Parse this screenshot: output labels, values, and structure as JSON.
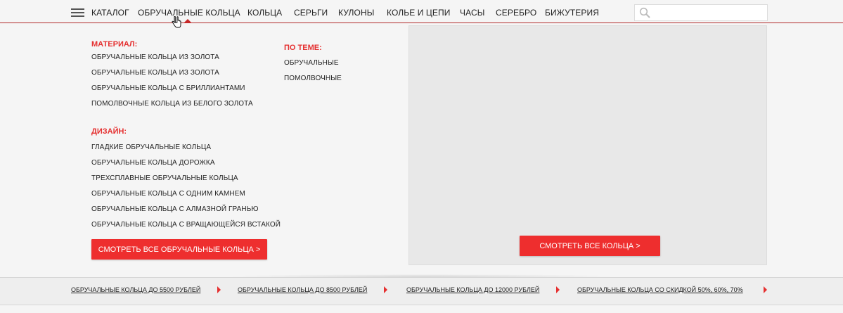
{
  "nav": {
    "catalog": "КАТАЛОГ",
    "items": [
      "ОБРУЧАЛЬНЫЕ КОЛЬЦА",
      "КОЛЬЦА",
      "СЕРЬГИ",
      "КУЛОНЫ",
      "КОЛЬЕ И ЦЕПИ",
      "ЧАСЫ",
      "СЕРЕБРО",
      "БИЖУТЕРИЯ"
    ],
    "active_index": 0
  },
  "search": {
    "placeholder": "",
    "value": ""
  },
  "dropdown": {
    "material": {
      "title": "МАТЕРИАЛ:",
      "links": [
        "ОБРУЧАЛЬНЫЕ КОЛЬЦА ИЗ ЗОЛОТА",
        "ОБРУЧАЛЬНЫЕ КОЛЬЦА ИЗ ЗОЛОТА",
        "ОБРУЧАЛЬНЫЕ КОЛЬЦА С БРИЛЛИАНТАМИ",
        "ПОМОЛВОЧНЫЕ КОЛЬЦА ИЗ БЕЛОГО ЗОЛОТА"
      ]
    },
    "design": {
      "title": "ДИЗАЙН:",
      "links": [
        "ГЛАДКИЕ ОБРУЧАЛЬНЫЕ КОЛЬЦА",
        "ОБРУЧАЛЬНЫЕ КОЛЬЦА ДОРОЖКА",
        "ТРЕХСПЛАВНЫЕ ОБРУЧАЛЬНЫЕ КОЛЬЦА",
        "ОБРУЧАЛЬНЫЕ КОЛЬЦА С ОДНИМ КАМНЕМ",
        "ОБРУЧАЛЬНЫЕ КОЛЬЦА С АЛМАЗНОЙ ГРАНЬЮ",
        "ОБРУЧАЛЬНЫЕ КОЛЬЦА С ВРАЩАЮЩЕЙСЯ ВСТАКОЙ"
      ]
    },
    "theme": {
      "title": "ПО ТЕМЕ:",
      "links": [
        "ОБРУЧАЛЬНЫЕ",
        "ПОМОЛВОЧНЫЕ"
      ]
    },
    "see_all_wedding_button": "СМОТРЕТЬ ВСЕ ОБРУЧАЛЬНЫЕ КОЛЬЦА >",
    "see_all_rings_button": "СМОТРЕТЬ ВСЕ  КОЛЬЦА >"
  },
  "bottom_links": [
    "ОБРУЧАЛЬНЫЕ КОЛЬЦА ДО 5500 РУБЛЕЙ",
    "ОБРУЧАЛЬНЫЕ КОЛЬЦА ДО 8500 РУБЛЕЙ",
    "ОБРУЧАЛЬНЫЕ КОЛЬЦА ДО 12000 РУБЛЕЙ",
    "ОБРУЧАЛЬНЫЕ КОЛЬЦА СО СКИДКОЙ 50%, 60%, 70%"
  ],
  "colors": {
    "accent": "#ee2e2e",
    "nav_border": "#b22a2a",
    "section_title": "#e53030",
    "background": "#f5f5f5",
    "image_placeholder": "#e8e8e8"
  },
  "icons": {
    "menu": "hamburger-icon",
    "search": "search-icon",
    "pointer": "hand-cursor-icon",
    "active": "caret-up-icon",
    "link_arrow": "triangle-right-icon"
  }
}
